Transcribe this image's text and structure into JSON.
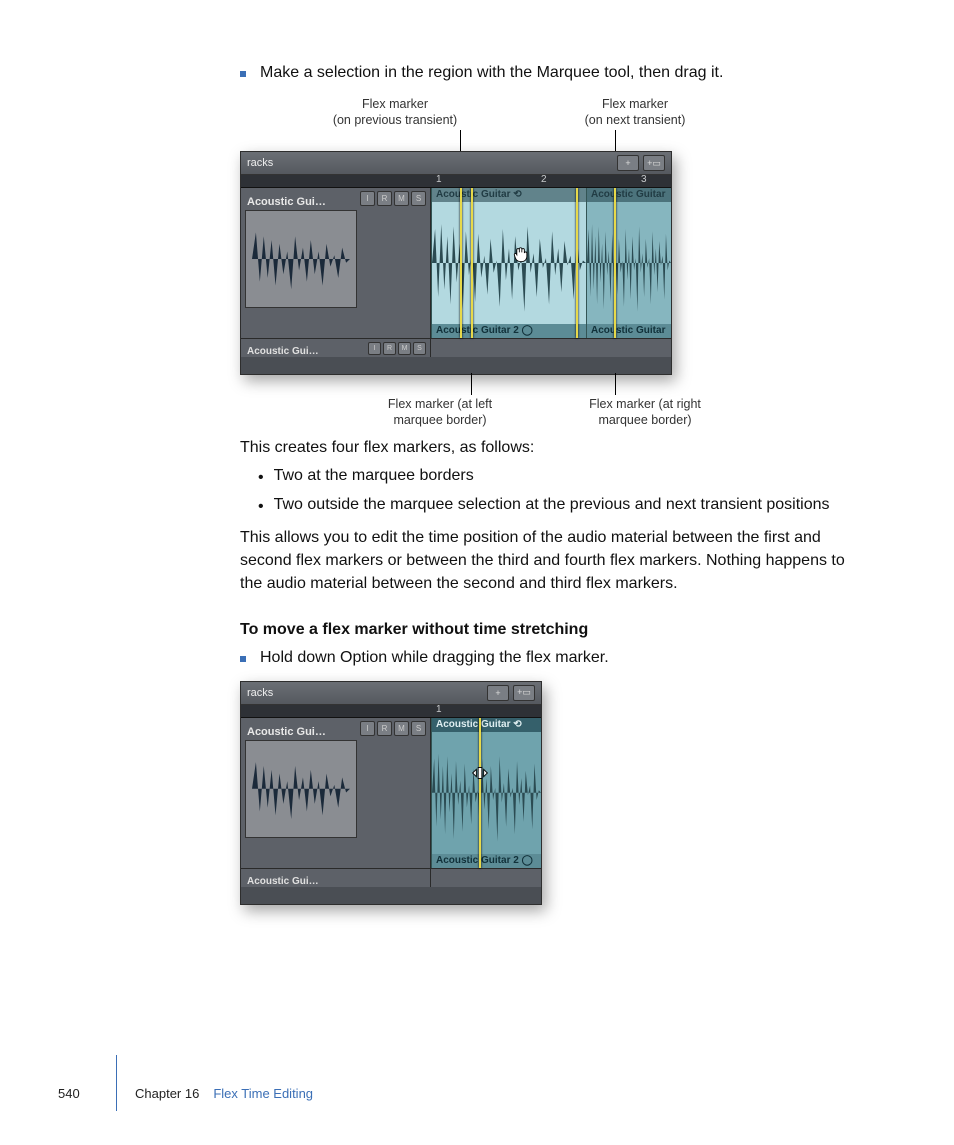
{
  "bullets": {
    "marquee": "Make a selection in the region with the Marquee tool, then drag it.",
    "option_drag": "Hold down Option while dragging the flex marker."
  },
  "callouts": {
    "top_left_a": "Flex marker",
    "top_left_b": "(on previous transient)",
    "top_right_a": "Flex marker",
    "top_right_b": "(on next transient)",
    "bot_left_a": "Flex marker (at left",
    "bot_left_b": "marquee border)",
    "bot_right_a": "Flex marker (at right",
    "bot_right_b": "marquee border)"
  },
  "body": {
    "p_intro": "This creates four flex markers, as follows:",
    "sub1": "Two at the marquee borders",
    "sub2": "Two outside the marquee selection at the previous and next transient positions",
    "p_explain": "This allows you to edit the time position of the audio material between the first and second flex markers or between the third and fourth flex markers. Nothing happens to the audio material between the second and third flex markers.",
    "heading2": "To move a flex marker without time stretching"
  },
  "figure": {
    "header": "racks",
    "btn_plus": "+",
    "btn_plusfile": "+▭",
    "ruler": {
      "n1": "1",
      "n2": "2",
      "n3": "3"
    },
    "track_name": "Acoustic Gui…",
    "track_name2": "Acoustic Gui…",
    "mini": {
      "i": "I",
      "r": "R",
      "m": "M",
      "s": "S"
    },
    "region1_top": "Acoustic Guitar ⟲",
    "region1_bot": "Acoustic Guitar 2 ◯",
    "region2_top": "Acoustic Guitar",
    "region2_bot": "Acoustic Guitar"
  },
  "footer": {
    "page": "540",
    "chapter": "Chapter 16",
    "title": "Flex Time Editing"
  }
}
